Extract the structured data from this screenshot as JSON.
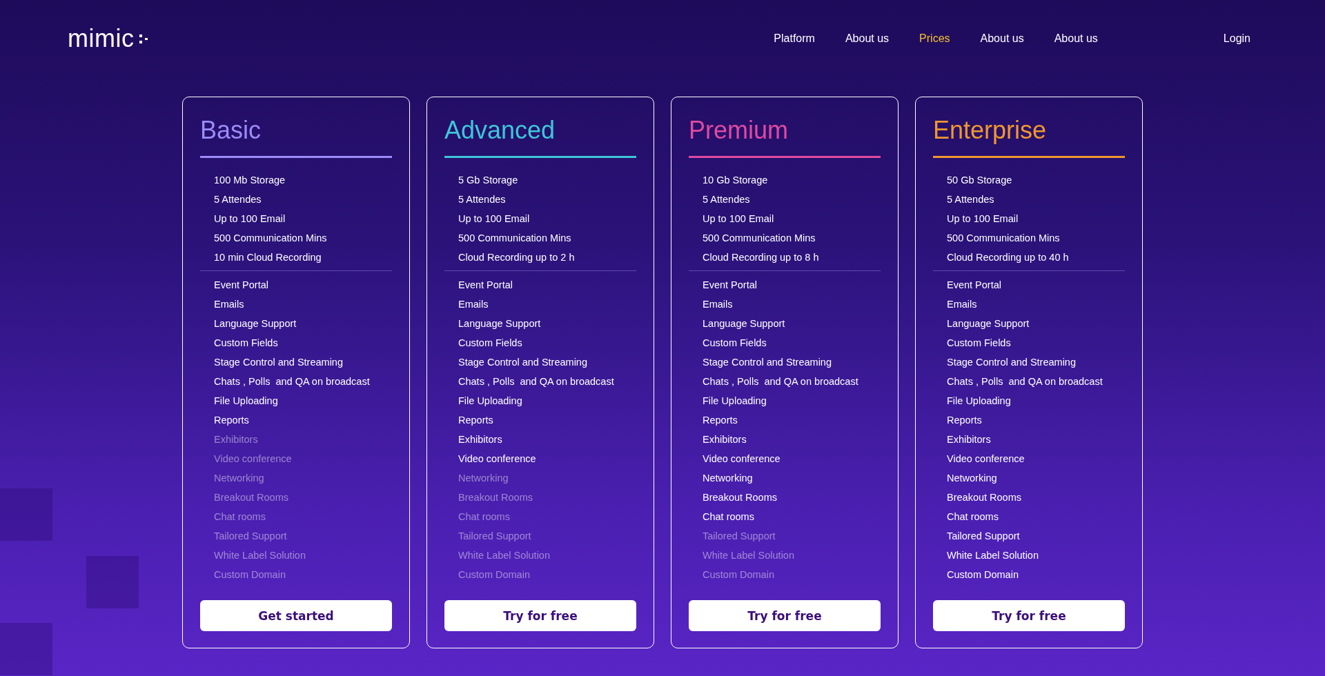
{
  "header": {
    "logo": "mimic",
    "nav": [
      {
        "label": "Platform",
        "selected": false
      },
      {
        "label": "About us",
        "selected": false
      },
      {
        "label": "Prices",
        "selected": true
      },
      {
        "label": "About us",
        "selected": false
      },
      {
        "label": "About us",
        "selected": false
      }
    ],
    "login": "Login"
  },
  "plans": [
    {
      "name": "Basic",
      "color": "#9b8cf7",
      "quotas": [
        "100 Mb Storage",
        "5 Attendes",
        "Up to 100 Email",
        "500 Communication Mins",
        "10 min Cloud Recording"
      ],
      "features": [
        {
          "label": "Event Portal",
          "included": true
        },
        {
          "label": "Emails",
          "included": true
        },
        {
          "label": "Language Support",
          "included": true
        },
        {
          "label": "Custom Fields",
          "included": true
        },
        {
          "label": "Stage Control and Streaming",
          "included": true
        },
        {
          "label": "Chats , Polls  and QA on broadcast",
          "included": true
        },
        {
          "label": "File Uploading",
          "included": true
        },
        {
          "label": "Reports",
          "included": true
        },
        {
          "label": "Exhibitors",
          "included": false
        },
        {
          "label": "Video conference",
          "included": false
        },
        {
          "label": "Networking",
          "included": false
        },
        {
          "label": "Breakout Rooms",
          "included": false
        },
        {
          "label": "Chat rooms",
          "included": false
        },
        {
          "label": "Tailored Support",
          "included": false
        },
        {
          "label": "White Label Solution",
          "included": false
        },
        {
          "label": "Custom Domain",
          "included": false
        }
      ],
      "button": "Get started"
    },
    {
      "name": "Advanced",
      "color": "#3ec6d8",
      "quotas": [
        "5 Gb Storage",
        "5 Attendes",
        "Up to 100 Email",
        "500 Communication Mins",
        "Cloud Recording up to 2 h"
      ],
      "features": [
        {
          "label": "Event Portal",
          "included": true
        },
        {
          "label": "Emails",
          "included": true
        },
        {
          "label": "Language Support",
          "included": true
        },
        {
          "label": "Custom Fields",
          "included": true
        },
        {
          "label": "Stage Control and Streaming",
          "included": true
        },
        {
          "label": "Chats , Polls  and QA on broadcast",
          "included": true
        },
        {
          "label": "File Uploading",
          "included": true
        },
        {
          "label": "Reports",
          "included": true
        },
        {
          "label": "Exhibitors",
          "included": true
        },
        {
          "label": "Video conference",
          "included": true
        },
        {
          "label": "Networking",
          "included": false
        },
        {
          "label": "Breakout Rooms",
          "included": false
        },
        {
          "label": "Chat rooms",
          "included": false
        },
        {
          "label": "Tailored Support",
          "included": false
        },
        {
          "label": "White Label Solution",
          "included": false
        },
        {
          "label": "Custom Domain",
          "included": false
        }
      ],
      "button": "Try for free"
    },
    {
      "name": "Premium",
      "color": "#e04aa2",
      "quotas": [
        "10 Gb Storage",
        "5 Attendes",
        "Up to 100 Email",
        "500 Communication Mins",
        "Cloud Recording up to 8 h"
      ],
      "features": [
        {
          "label": "Event Portal",
          "included": true
        },
        {
          "label": "Emails",
          "included": true
        },
        {
          "label": "Language Support",
          "included": true
        },
        {
          "label": "Custom Fields",
          "included": true
        },
        {
          "label": "Stage Control and Streaming",
          "included": true
        },
        {
          "label": "Chats , Polls  and QA on broadcast",
          "included": true
        },
        {
          "label": "File Uploading",
          "included": true
        },
        {
          "label": "Reports",
          "included": true
        },
        {
          "label": "Exhibitors",
          "included": true
        },
        {
          "label": "Video conference",
          "included": true
        },
        {
          "label": "Networking",
          "included": true
        },
        {
          "label": "Breakout Rooms",
          "included": true
        },
        {
          "label": "Chat rooms",
          "included": true
        },
        {
          "label": "Tailored Support",
          "included": false
        },
        {
          "label": "White Label Solution",
          "included": false
        },
        {
          "label": "Custom Domain",
          "included": false
        }
      ],
      "button": "Try for free"
    },
    {
      "name": "Enterprise",
      "color": "#f0972e",
      "quotas": [
        "50 Gb Storage",
        "5 Attendes",
        "Up to 100 Email",
        "500 Communication Mins",
        "Cloud Recording up to 40 h"
      ],
      "features": [
        {
          "label": "Event Portal",
          "included": true
        },
        {
          "label": "Emails",
          "included": true
        },
        {
          "label": "Language Support",
          "included": true
        },
        {
          "label": "Custom Fields",
          "included": true
        },
        {
          "label": "Stage Control and Streaming",
          "included": true
        },
        {
          "label": "Chats , Polls  and QA on broadcast",
          "included": true
        },
        {
          "label": "File Uploading",
          "included": true
        },
        {
          "label": "Reports",
          "included": true
        },
        {
          "label": "Exhibitors",
          "included": true
        },
        {
          "label": "Video conference",
          "included": true
        },
        {
          "label": "Networking",
          "included": true
        },
        {
          "label": "Breakout Rooms",
          "included": true
        },
        {
          "label": "Chat rooms",
          "included": true
        },
        {
          "label": "Tailored Support",
          "included": true
        },
        {
          "label": "White Label Solution",
          "included": true
        },
        {
          "label": "Custom Domain",
          "included": true
        }
      ],
      "button": "Try for free"
    }
  ]
}
